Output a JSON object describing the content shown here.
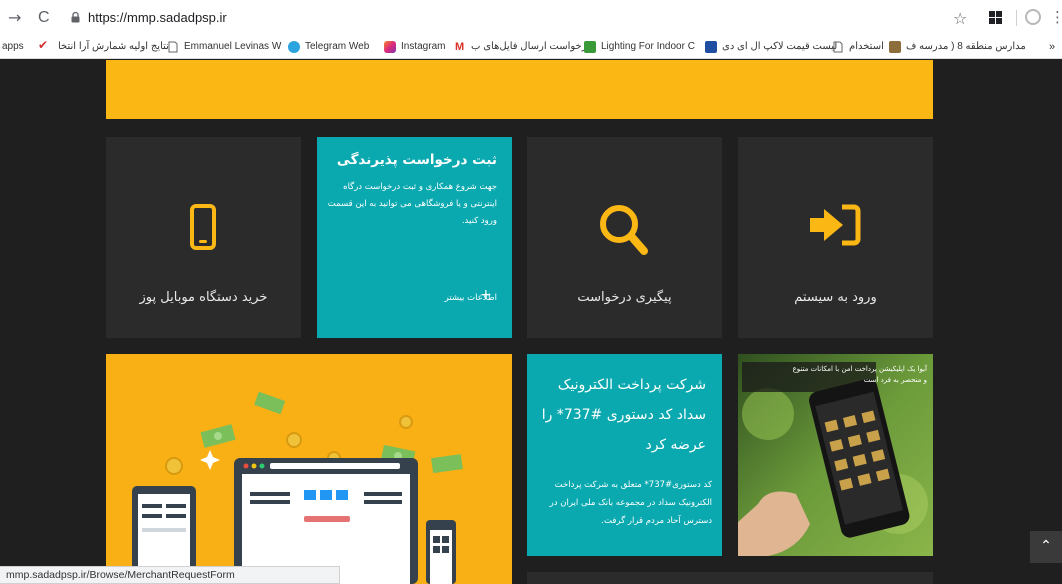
{
  "browser": {
    "back_glyph": "→",
    "reload_glyph": "C",
    "url": "https://mmp.sadadpsp.ir",
    "star_glyph": "☆",
    "menu_glyph": "⋮",
    "bookmarks_overflow": "»",
    "bookmarks": [
      {
        "label": "apps",
        "icon": "apps-icon"
      },
      {
        "label": "نتایج اولیه شمارش آرا انتخا",
        "icon": "checkmark-icon"
      },
      {
        "label": "Emmanuel Levinas W",
        "icon": "page-icon"
      },
      {
        "label": "Telegram Web",
        "icon": "telegram-icon"
      },
      {
        "label": "Instagram",
        "icon": "instagram-icon"
      },
      {
        "label": "درخواست ارسال فایل‌های ب",
        "icon": "gmail-icon"
      },
      {
        "label": "Lighting For Indoor C",
        "icon": "bookmark-green-icon"
      },
      {
        "label": "لیست قیمت لاکپ ال ای دی",
        "icon": "bookmark-blue-icon"
      },
      {
        "label": "استخدام",
        "icon": "page-icon"
      },
      {
        "label": "مدارس منطقه 8 ( مدرسه ف",
        "icon": "bookmark-image-icon"
      }
    ]
  },
  "tiles": {
    "login": {
      "label": "ورود به سیستم",
      "icon": "login-arrow-icon"
    },
    "tracking": {
      "label": "پیگیری درخواست",
      "icon": "search-icon"
    },
    "register": {
      "title": "ثبت درخواست پذیرندگی",
      "description": "جهت شروع همکاری و ثبت درخواست درگاه اینترنتی و یا فروشگاهی می توانید به این قسمت ورود کنید.",
      "more_label": "اطلاعات بیشتر",
      "plus_glyph": "+"
    },
    "buy_pos": {
      "label": "خرید دستگاه موبایل پوز",
      "icon": "mobile-phone-icon"
    }
  },
  "promos": {
    "ussd": {
      "title": "شرکت پرداخت الکترونیک سداد کد دستوری #737* را عرضه کرد",
      "description": "کد دستوری#737* متعلق به شرکت پرداخت الکترونیک سداد در مجموعه بانک ملی ایران در دسترس آحاد مردم قرار گرفت."
    },
    "app": {
      "caption": "آیوا یک اپلیکیشن پرداخت امن با امکانات متنوع و منحصر به فرد است"
    }
  },
  "scroll_top_glyph": "⌃",
  "status_url": "mmp.sadadpsp.ir/Browse/MerchantRequestForm",
  "colors": {
    "brand_yellow": "#fbb714",
    "teal": "#0aa9b0",
    "dark_bg": "#1f1f1f",
    "tile_bg": "#2b2b2b"
  }
}
